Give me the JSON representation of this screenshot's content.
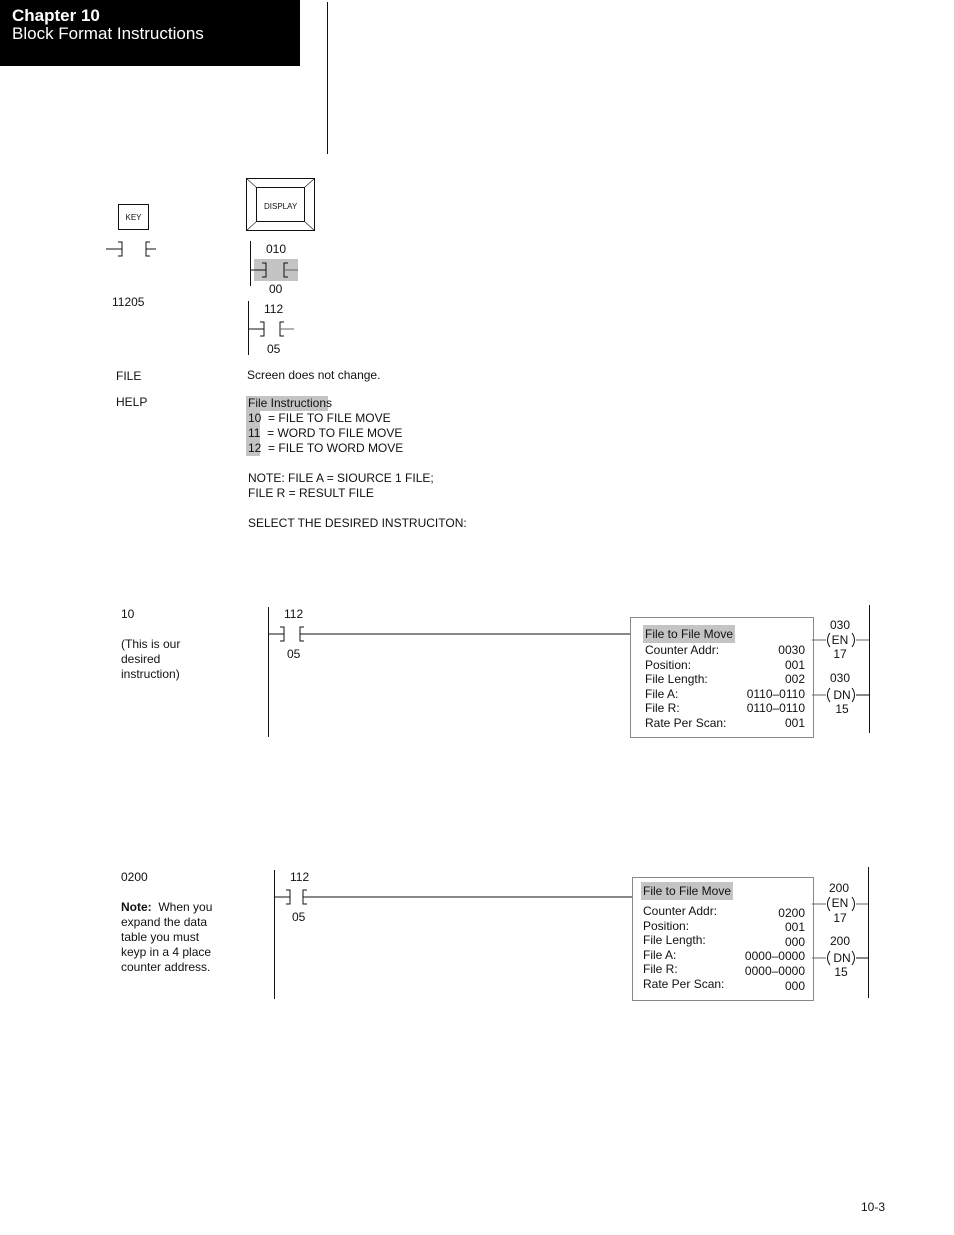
{
  "header": {
    "chapter": "Chapter 10",
    "title": "Block Format Instructions"
  },
  "step1": {
    "key_label": "KEY",
    "display_label": "DISPLAY",
    "address_entry": "11205",
    "contact_a": {
      "top": "010",
      "bottom": "00"
    },
    "contact_b": {
      "top": "112",
      "bottom": "05"
    }
  },
  "step2": {
    "key": "FILE",
    "result": "Screen does not change."
  },
  "step3": {
    "key": "HELP",
    "menu_title": "File Instructions",
    "menu_items": [
      {
        "code": "10",
        "label": "=  FILE TO FILE MOVE"
      },
      {
        "code": "11",
        "label": "=  WORD TO FILE MOVE"
      },
      {
        "code": "12",
        "label": "=  FILE TO WORD MOVE"
      }
    ],
    "note_line1": "NOTE:  FILE A  =  SIOURCE 1 FILE;",
    "note_line2": "FILE R  = RESULT FILE",
    "prompt": "SELECT THE DESIRED INSTRUCITON:"
  },
  "step4": {
    "key": "10",
    "comment": [
      "(This is our",
      "desired",
      "instruction)"
    ],
    "contact": {
      "top": "112",
      "bottom": "05"
    },
    "block": {
      "title": "File to File Move",
      "rows": [
        {
          "label": "Counter Addr:",
          "value": "0030"
        },
        {
          "label": "Position:",
          "value": "001"
        },
        {
          "label": "File Length:",
          "value": "002"
        },
        {
          "label": "File A:",
          "value": "0110–0110"
        },
        {
          "label": "File R:",
          "value": "0110–0110"
        },
        {
          "label": "Rate Per Scan:",
          "value": "001"
        }
      ]
    },
    "coil_en": {
      "top": "030",
      "mid": "EN",
      "bottom": "17"
    },
    "coil_dn": {
      "top": "030",
      "mid": "DN",
      "bottom": "15"
    }
  },
  "step5": {
    "key": "0200",
    "note_bold": "Note:",
    "note_rest": [
      "When you",
      "expand the data",
      "table you must",
      "keyp in a 4 place",
      "counter address."
    ],
    "contact": {
      "top": "112",
      "bottom": "05"
    },
    "block": {
      "title": "File to File Move",
      "rows": [
        {
          "label": "Counter Addr:",
          "value": "0200"
        },
        {
          "label": "Position:",
          "value": "001"
        },
        {
          "label": "File Length:",
          "value": "000"
        },
        {
          "label": "File A:",
          "value": "0000–0000"
        },
        {
          "label": "File R:",
          "value": "0000–0000"
        },
        {
          "label": "Rate Per Scan:",
          "value": "000"
        }
      ]
    },
    "coil_en": {
      "top": "200",
      "mid": "EN",
      "bottom": "17"
    },
    "coil_dn": {
      "top": "200",
      "mid": "DN",
      "bottom": "15"
    }
  },
  "footer": {
    "page_number": "10-3"
  }
}
